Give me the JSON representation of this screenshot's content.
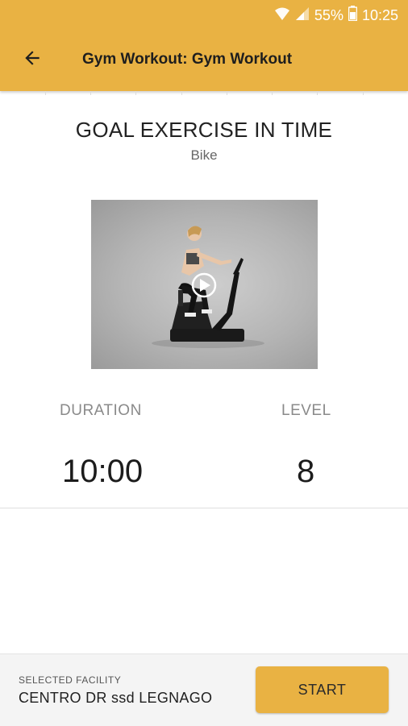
{
  "status": {
    "battery": "55%",
    "time": "10:25"
  },
  "toolbar": {
    "title": "Gym Workout: Gym Workout"
  },
  "exercise": {
    "goal": "GOAL EXERCISE IN TIME",
    "name": "Bike"
  },
  "stats": {
    "duration_label": "DURATION",
    "duration_value": "10:00",
    "level_label": "LEVEL",
    "level_value": "8"
  },
  "facility": {
    "label": "SELECTED FACILITY",
    "name": "CENTRO DR ssd LEGNAGO"
  },
  "actions": {
    "start_label": "START"
  },
  "colors": {
    "accent": "#e9b243"
  }
}
